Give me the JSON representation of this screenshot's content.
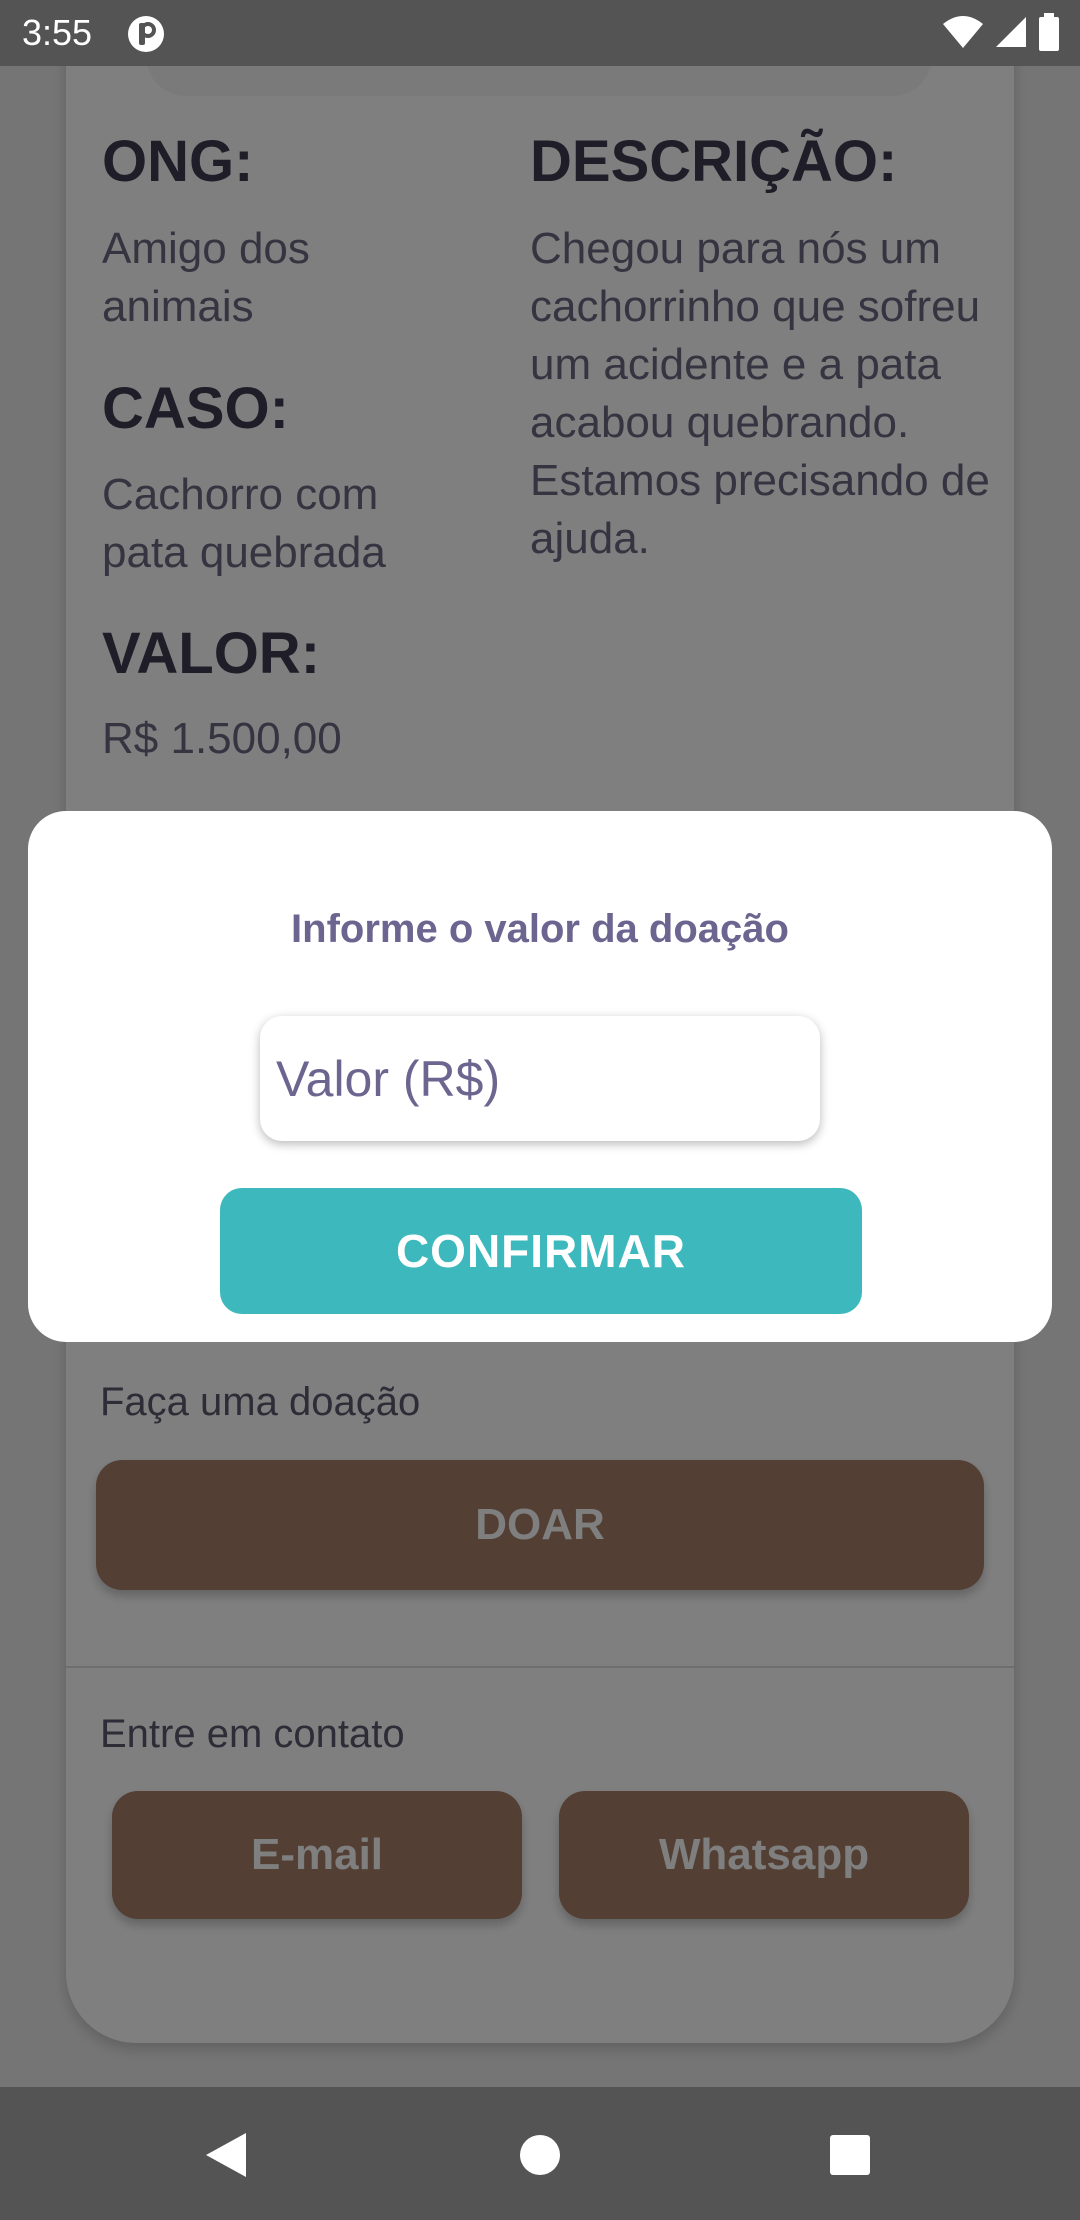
{
  "status_bar": {
    "time": "3:55",
    "icons": [
      "app-notification-icon",
      "wifi-icon",
      "cell-signal-icon",
      "battery-icon"
    ]
  },
  "details": {
    "ong_label": "ONG:",
    "ong_value": "Amigo dos animais",
    "caso_label": "CASO:",
    "caso_value": "Cachorro com pata quebrada",
    "descricao_label": "DESCRIÇÃO:",
    "descricao_value": "Chegou para nós um cachorrinho que sofreu um acidente e a pata acabou quebrando. Estamos precisando de ajuda.",
    "valor_label": "VALOR:",
    "valor_value": "R$ 1.500,00"
  },
  "donation": {
    "label": "Faça uma doação",
    "button_label": "DOAR"
  },
  "contact": {
    "label": "Entre em contato",
    "email_label": "E-mail",
    "whatsapp_label": "Whatsapp"
  },
  "dialog": {
    "title": "Informe o valor da doação",
    "input_placeholder": "Valor (R$)",
    "input_value": "",
    "confirm_label": "CONFIRMAR"
  },
  "nav_bar": {
    "icons": [
      "back-icon",
      "home-icon",
      "recents-icon"
    ]
  },
  "colors": {
    "accent_teal": "#3db8bd",
    "brown_button": "#a67f67",
    "dialog_title": "#6b6590",
    "heading": "#3e3b4f"
  }
}
